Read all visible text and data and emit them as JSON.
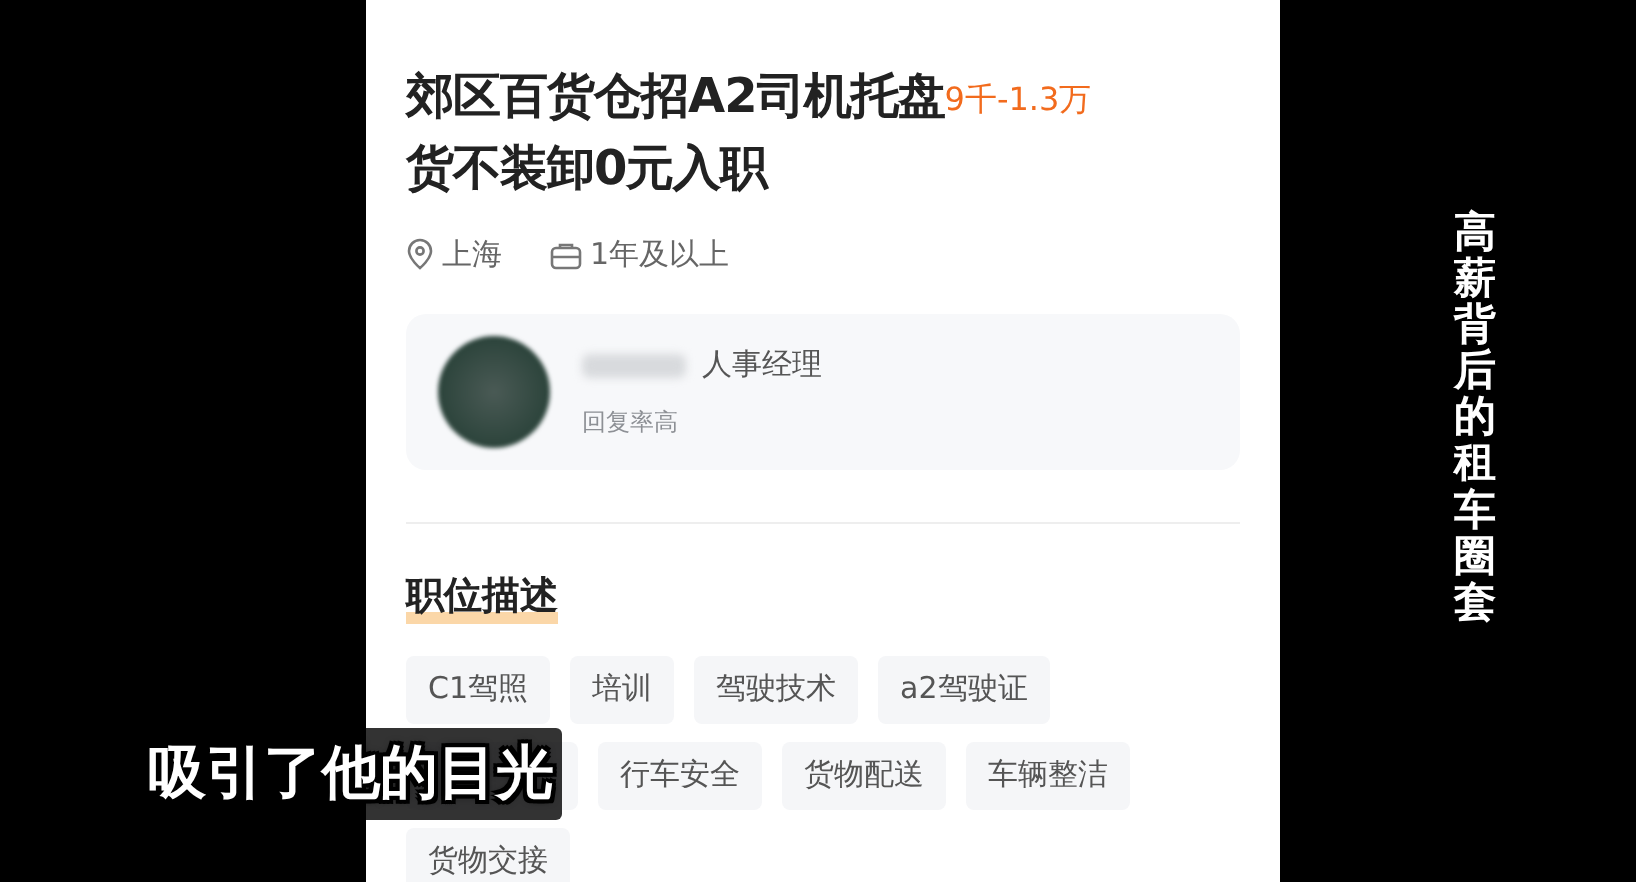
{
  "job": {
    "title_lines": [
      "郊区百货仓招A2司机托盘",
      "货不装卸0元入职"
    ],
    "salary": "9千-1.3万",
    "location": "上海",
    "experience": "1年及以上"
  },
  "recruiter": {
    "role": "人事经理",
    "note": "回复率高"
  },
  "description": {
    "heading": "职位描述",
    "tags": [
      {
        "kind": "tag",
        "label": "C1驾照"
      },
      {
        "kind": "tag",
        "label": "培训"
      },
      {
        "kind": "tag",
        "label": "驾驶技术"
      },
      {
        "kind": "tag",
        "label": "a2驾驶证"
      },
      {
        "kind": "covered"
      },
      {
        "kind": "tag",
        "label": "行车安全"
      },
      {
        "kind": "tag",
        "label": "货物配送"
      },
      {
        "kind": "tag",
        "label": "车辆整洁"
      },
      {
        "kind": "tag",
        "label": "货物交接"
      }
    ]
  },
  "captions": {
    "side": "高薪背后的租车圈套",
    "subtitle": "吸引了他的目光"
  }
}
